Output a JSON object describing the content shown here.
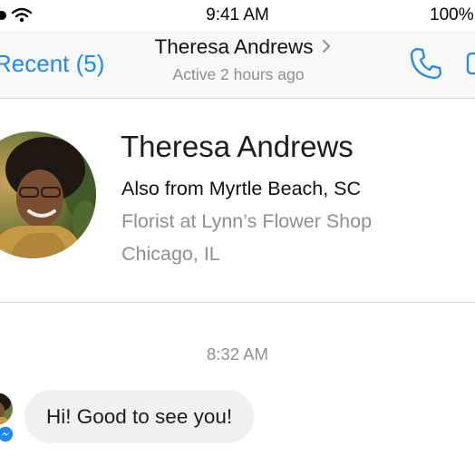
{
  "status_bar": {
    "time": "9:41 AM",
    "battery": "100%",
    "icons": [
      "signal-dot-icon",
      "wifi-icon"
    ]
  },
  "nav": {
    "back_label": "Recent (5)",
    "title": "Theresa Andrews",
    "subtitle": "Active 2 hours ago",
    "icons": [
      "chevron-right-icon",
      "phone-icon",
      "video-camera-icon"
    ],
    "accent_color": "#1e88f5"
  },
  "profile": {
    "name": "Theresa Andrews",
    "mutual": "Also from Myrtle Beach, SC",
    "job": "Florist at Lynn’s Flower Shop",
    "location": "Chicago, IL"
  },
  "conversation": {
    "timestamp": "8:32 AM",
    "messages": [
      {
        "sender": "Theresa Andrews",
        "text": "Hi! Good to see you!"
      }
    ],
    "bubble_color": "#f1f0f0"
  }
}
